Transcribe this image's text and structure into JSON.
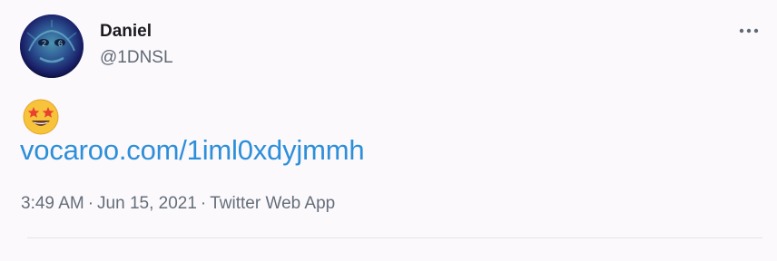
{
  "tweet": {
    "author_name": "Daniel",
    "author_handle": "@1DNSL",
    "avatar_icon": "profile-avatar",
    "more_icon": "more-options-icon",
    "emoji": "star-struck",
    "link_text": "vocaroo.com/1iml0xdyjmmh",
    "time": "3:49 AM",
    "date": "Jun 15, 2021",
    "source": "Twitter Web App",
    "separator": "·"
  },
  "colors": {
    "background": "#fcf9fd",
    "link": "#2d8fd9",
    "muted_text": "#646e79",
    "name_text": "#1b1b1f"
  }
}
